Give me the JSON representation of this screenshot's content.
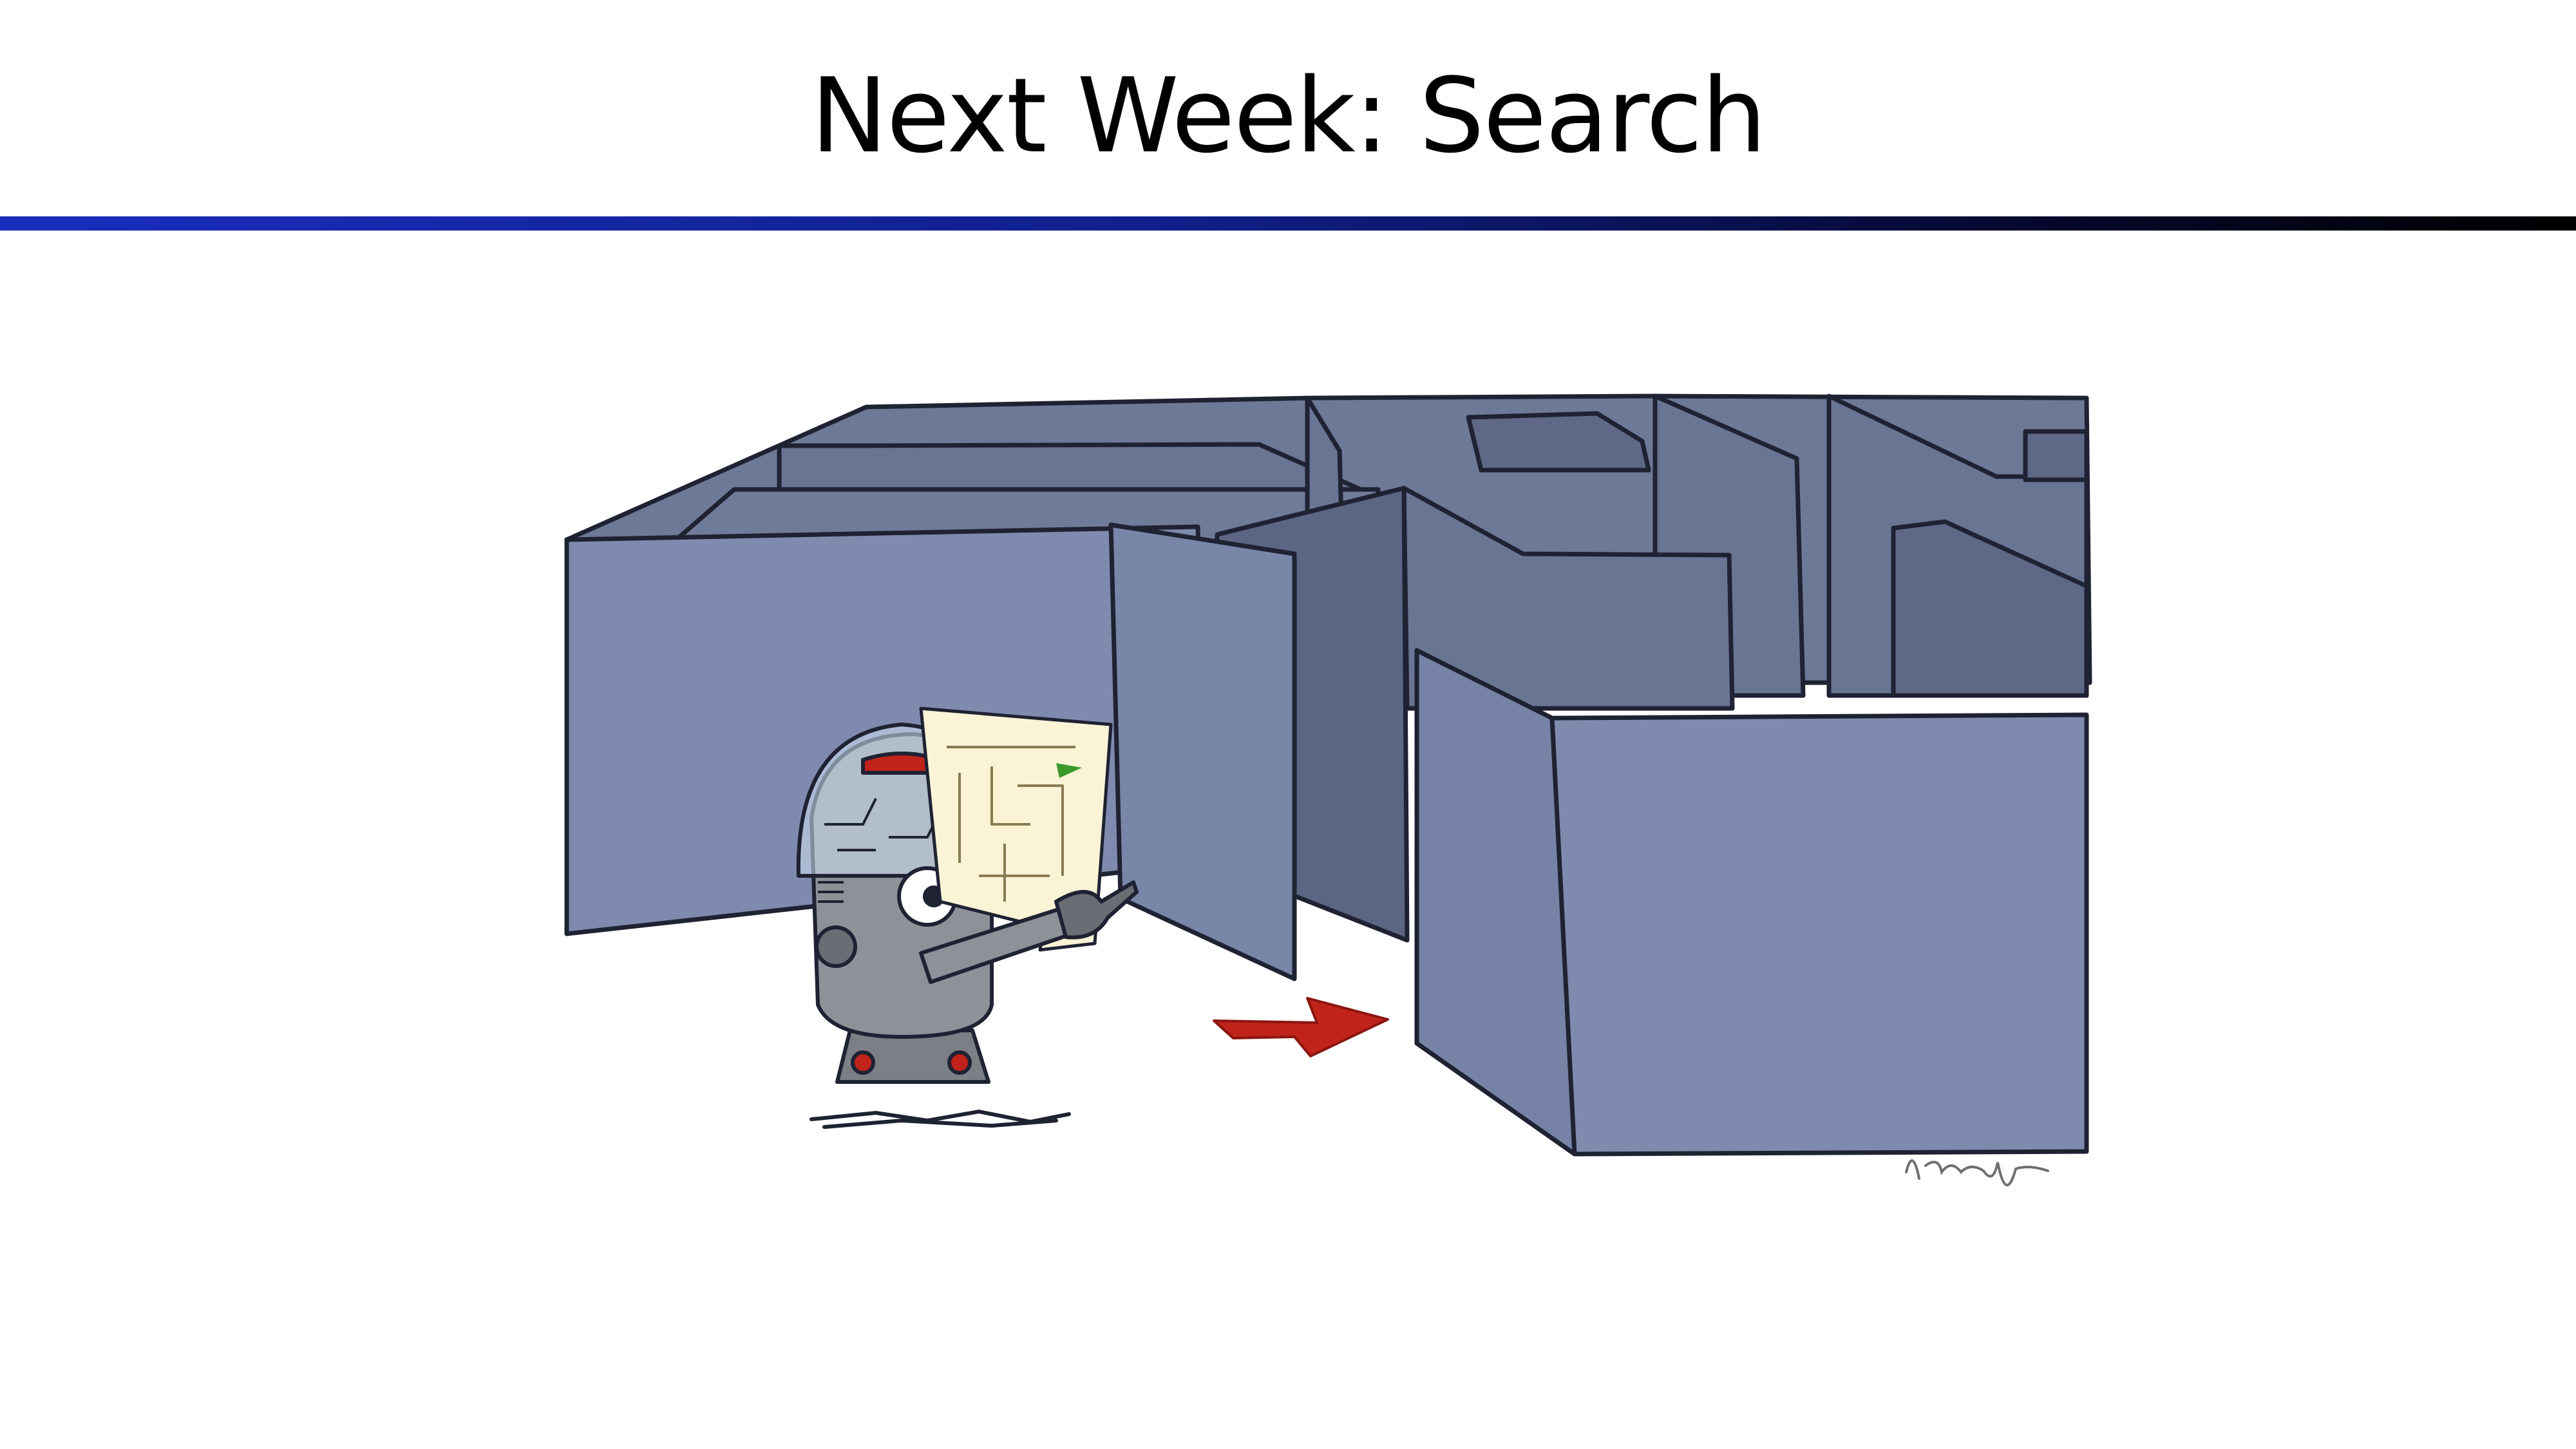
{
  "slide": {
    "title": "Next Week: Search"
  },
  "illustration": {
    "subject": "robot-reading-maze-map",
    "signature": "Ketrina Yim",
    "colors": {
      "wall_front": "#7f8aae",
      "wall_top": "#6e7897",
      "wall_inner": "#6a7493",
      "outline": "#1e2232",
      "floor": "#ffffff",
      "arrow": "#c0231a",
      "robot_body": "#8e9198",
      "map_paper": "#fbf3d6"
    }
  },
  "rule_colors": {
    "start": "#1a2dbd",
    "end": "#000000"
  }
}
